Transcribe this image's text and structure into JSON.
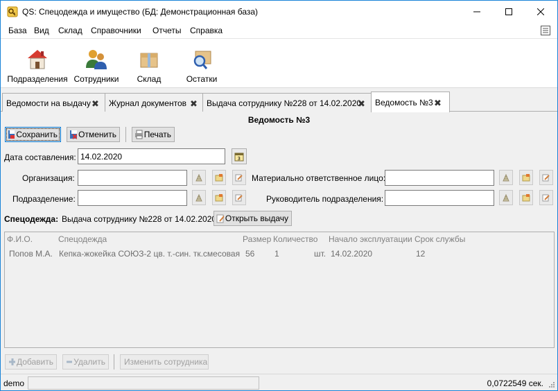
{
  "window": {
    "title": "QS: Спецодежда и имущество (БД: Демонстрационная база)",
    "icon": "app-key-icon"
  },
  "menu": [
    "База",
    "Вид",
    "Склад",
    "Справочники",
    "Отчеты",
    "Справка"
  ],
  "toolbar": [
    {
      "label": "Подразделения",
      "icon": "house-icon"
    },
    {
      "label": "Сотрудники",
      "icon": "people-icon"
    },
    {
      "label": "Склад",
      "icon": "box-icon"
    },
    {
      "label": "Остатки",
      "icon": "search-box-icon"
    }
  ],
  "tabs": [
    {
      "label": "Ведомости на выдачу",
      "active": false
    },
    {
      "label": "Журнал документов",
      "active": false
    },
    {
      "label": "Выдача сотруднику №228 от 14.02.2020",
      "active": false
    },
    {
      "label": "Ведомость №3",
      "active": true
    }
  ],
  "doc": {
    "title": "Ведомость №3",
    "save_label": "Сохранить",
    "cancel_label": "Отменить",
    "print_label": "Печать",
    "date_label": "Дата составления:",
    "date_value": "14.02.2020",
    "org_label": "Организация:",
    "org_value": "",
    "dept_label": "Подразделение:",
    "dept_value": "",
    "resp_label": "Материально ответственное лицо:",
    "resp_value": "",
    "head_label": "Руководитель подразделения:",
    "head_value": "",
    "workwear_label": "Спецодежда:",
    "workwear_value": "Выдача сотруднику №228 от 14.02.2020",
    "open_issue_label": "Открыть выдачу"
  },
  "grid": {
    "columns": [
      "Ф.И.О.",
      "Спецодежда",
      "Размер",
      "Количество",
      "Начало эксплуатации",
      "Срок службы"
    ],
    "rows": [
      {
        "fio": "Попов М.А.",
        "item": "Кепка-жокейка СОЮЗ-2 цв. т.-син. тк.смесовая",
        "size": "56",
        "qty": "1",
        "unit": "шт.",
        "start": "14.02.2020",
        "term": "12"
      }
    ]
  },
  "bottom_buttons": {
    "add": "Добавить",
    "remove": "Удалить",
    "change_employee": "Изменить сотрудника"
  },
  "status": {
    "user": "demo",
    "time": "0,0722549 сек."
  }
}
